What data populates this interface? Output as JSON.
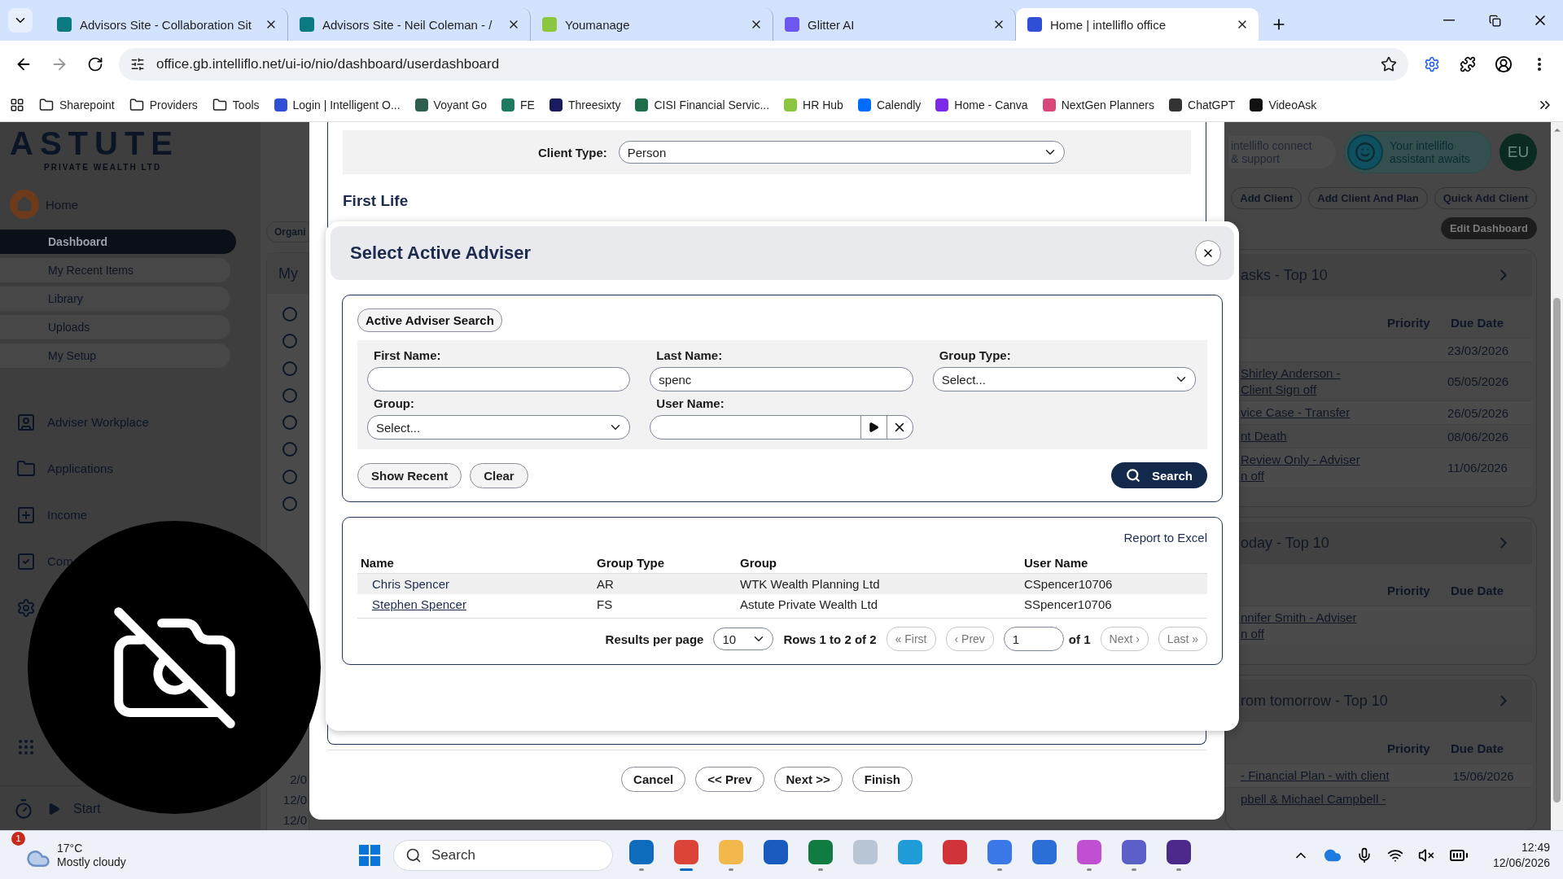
{
  "browser": {
    "tabs": [
      {
        "title": "Advisors Site - Collaboration Sit",
        "color": "#0b7a80",
        "selected": false
      },
      {
        "title": "Advisors Site - Neil Coleman - /",
        "color": "#0b7a80",
        "selected": false
      },
      {
        "title": "Youmanage",
        "color": "#8cc63f",
        "selected": false
      },
      {
        "title": "Glitter AI",
        "color": "#6e56f0",
        "selected": false
      },
      {
        "title": "Home | intelliflo office",
        "color": "#2f4fd6",
        "selected": true
      }
    ],
    "url": "office.gb.intelliflo.net/ui-io/nio/dashboard/userdashboard",
    "bookmarks": [
      {
        "label": "Sharepoint",
        "kind": "folder"
      },
      {
        "label": "Providers",
        "kind": "folder"
      },
      {
        "label": "Tools",
        "kind": "folder"
      },
      {
        "label": "Login | Intelligent O...",
        "kind": "site",
        "color": "#2f4fd6"
      },
      {
        "label": "Voyant Go",
        "kind": "site",
        "color": "#2e5e4e"
      },
      {
        "label": "FE",
        "kind": "site",
        "color": "#1d7a5f"
      },
      {
        "label": "Threesixty",
        "kind": "site",
        "color": "#1a1a5e"
      },
      {
        "label": "CISI Financial Servic...",
        "kind": "site",
        "color": "#1f6e4a"
      },
      {
        "label": "HR Hub",
        "kind": "site",
        "color": "#8cc63f"
      },
      {
        "label": "Calendly",
        "kind": "site",
        "color": "#006bff"
      },
      {
        "label": "Home - Canva",
        "kind": "site",
        "color": "#7d2ae8"
      },
      {
        "label": "NextGen Planners",
        "kind": "site",
        "color": "#d9467a"
      },
      {
        "label": "ChatGPT",
        "kind": "site",
        "color": "#333333"
      },
      {
        "label": "VideoAsk",
        "kind": "site",
        "color": "#111111"
      }
    ]
  },
  "sidebar": {
    "logo": "ASTUTE",
    "tagline": "PRIVATE WEALTH LTD",
    "home": "Home",
    "sub_items": [
      {
        "label": "Dashboard",
        "selected": true
      },
      {
        "label": "My Recent Items",
        "selected": false
      },
      {
        "label": "Library",
        "selected": false
      },
      {
        "label": "Uploads",
        "selected": false
      },
      {
        "label": "My Setup",
        "selected": false
      }
    ],
    "sections": [
      {
        "kind": "person",
        "label": "Adviser Workplace"
      },
      {
        "kind": "folder",
        "label": "Applications"
      },
      {
        "kind": "plus",
        "label": "Income"
      },
      {
        "kind": "check",
        "label": "Com"
      },
      {
        "kind": "gear"
      },
      {
        "kind": "grid"
      }
    ],
    "timer": "Start"
  },
  "dashboard_left": {
    "filter": "Organi",
    "panel_title": "My",
    "rows": [
      {
        "checked": false
      },
      {
        "checked": false
      },
      {
        "checked": false
      },
      {
        "checked": false
      },
      {
        "checked": false
      },
      {
        "checked": false
      },
      {
        "checked": false
      },
      {
        "checked": false
      }
    ],
    "dates": [
      "2/0",
      "12/0",
      "12/0"
    ]
  },
  "dashboard_right": {
    "connect": "intelliflo connect & support",
    "assistant": "Your intelliflo assistant awaits",
    "avatar": "EU",
    "actions": [
      "Add Client",
      "Add Client And Plan",
      "Quick Add Client"
    ],
    "edit": "Edit Dashboard",
    "cards": [
      {
        "title": "asks - Top 10",
        "columns": [
          "Priority",
          "Due Date"
        ],
        "rows": [
          {
            "due": "23/03/2026"
          },
          {
            "lines": [
              "Shirley Anderson -",
              "Client Sign off"
            ],
            "due": "05/05/2026"
          },
          {
            "lines": [
              "vice Case - Transfer"
            ],
            "due": "26/05/2026"
          },
          {
            "lines": [
              "nt Death"
            ],
            "due": "08/06/2026"
          },
          {
            "lines": [
              "Review Only - Adviser",
              "n off"
            ],
            "due": "11/06/2026"
          }
        ]
      },
      {
        "title": "oday - Top 10",
        "columns": [
          "Priority",
          "Due Date"
        ],
        "rows": [
          {
            "lines": [
              "nnifer Smith - Adviser",
              "n off"
            ]
          }
        ]
      },
      {
        "title": "rom tomorrow - Top 10",
        "columns": [
          "Priority",
          "Due Date"
        ],
        "rows": [
          {
            "lines": [
              "- Financial Plan - with client"
            ],
            "due": "15/06/2026"
          },
          {
            "lines": [
              "pbell & Michael Campbell -"
            ]
          }
        ]
      }
    ]
  },
  "wizard": {
    "client_type_label": "Client Type:",
    "client_type": "Person",
    "section": "First Life",
    "buttons": [
      "Cancel",
      "<< Prev",
      "Next >>",
      "Finish"
    ]
  },
  "modal": {
    "title": "Select Active Adviser",
    "legend": "Active Adviser Search",
    "first_name": {
      "label": "First Name:"
    },
    "last_name": {
      "label": "Last Name:",
      "value": "spenc"
    },
    "group_type": {
      "label": "Group Type:",
      "value": "Select..."
    },
    "group": {
      "label": "Group:",
      "value": "Select..."
    },
    "user_name": {
      "label": "User Name:"
    },
    "buttons": [
      "Show Recent",
      "Clear"
    ],
    "search": "Search",
    "report": "Report to Excel",
    "columns": [
      "Name",
      "Group Type",
      "Group",
      "User Name"
    ],
    "rows": [
      {
        "name": "Chris Spencer",
        "group_type": "AR",
        "group": "WTK Wealth Planning Ltd",
        "user_name": "CSpencer10706",
        "hovered": false
      },
      {
        "name": "Stephen Spencer",
        "group_type": "FS",
        "group": "Astute Private Wealth Ltd",
        "user_name": "SSpencer10706",
        "hovered": true
      }
    ],
    "pagination": {
      "per_page_label": "Results per page",
      "per_page": "10",
      "rows_info": "Rows 1 to 2 of 2",
      "first": "« First",
      "prev": "‹ Prev",
      "page": "1",
      "of": "of 1",
      "next": "Next ›",
      "last": "Last »",
      "disabled": true
    }
  },
  "taskbar": {
    "weather": {
      "badge": "1",
      "temp": "17°C",
      "desc": "Mostly cloudy"
    },
    "search": "Search",
    "apps": [
      {
        "color": "#0f6cbd",
        "active": false,
        "running": true
      },
      {
        "color": "#db4437",
        "active": true,
        "running": true
      },
      {
        "color": "#f2b84b",
        "active": false,
        "running": true
      },
      {
        "color": "#185abd",
        "active": false,
        "running": false
      },
      {
        "color": "#107c41",
        "active": false,
        "running": true
      },
      {
        "color": "#b8c6d6",
        "active": false,
        "running": false
      },
      {
        "color": "#1f9bd8",
        "active": false,
        "running": false
      },
      {
        "color": "#d13438",
        "active": false,
        "running": false
      },
      {
        "color": "#3b78e7",
        "active": false,
        "running": true
      },
      {
        "color": "#2b6fd6",
        "active": false,
        "running": false
      },
      {
        "color": "#c04fd1",
        "active": false,
        "running": true
      },
      {
        "color": "#5b5fc7",
        "active": false,
        "running": true
      },
      {
        "color": "#4b2a8a",
        "active": false,
        "running": true
      }
    ],
    "time": "12:49",
    "date": "12/06/2026"
  }
}
